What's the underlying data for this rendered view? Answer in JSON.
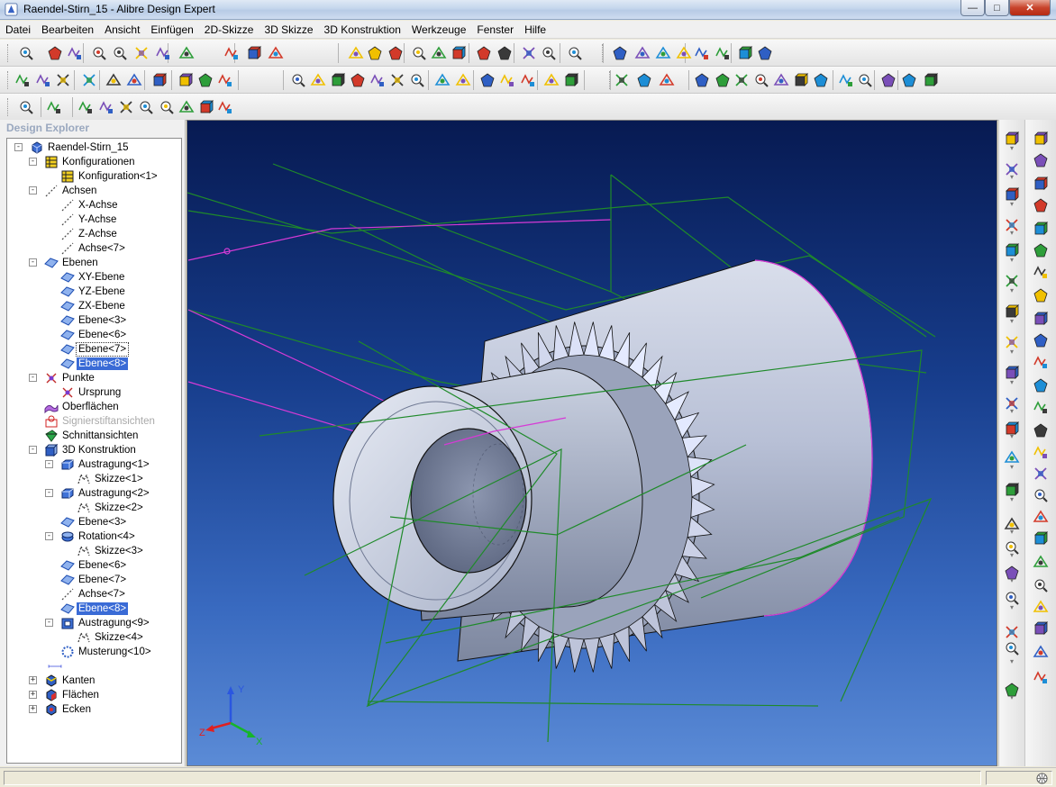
{
  "window": {
    "title": "Raendel-Stirn_15 - Alibre Design Expert"
  },
  "menu": [
    "Datei",
    "Bearbeiten",
    "Ansicht",
    "Einfügen",
    "2D-Skizze",
    "3D Skizze",
    "3D Konstruktion",
    "Werkzeuge",
    "Fenster",
    "Hilfe"
  ],
  "explorer": {
    "title": "Design Explorer",
    "tree": [
      {
        "label": "Raendel-Stirn_15",
        "icon": "part-icon",
        "depth": 0,
        "expander": "-"
      },
      {
        "label": "Konfigurationen",
        "icon": "table-icon",
        "depth": 1,
        "expander": "-"
      },
      {
        "label": "Konfiguration<1>",
        "icon": "table-icon",
        "depth": 2,
        "expander": ""
      },
      {
        "label": "Achsen",
        "icon": "axis-icon",
        "depth": 1,
        "expander": "-"
      },
      {
        "label": "X-Achse",
        "icon": "axis-icon",
        "depth": 2,
        "expander": ""
      },
      {
        "label": "Y-Achse",
        "icon": "axis-icon",
        "depth": 2,
        "expander": ""
      },
      {
        "label": "Z-Achse",
        "icon": "axis-icon",
        "depth": 2,
        "expander": ""
      },
      {
        "label": "Achse<7>",
        "icon": "axis-icon",
        "depth": 2,
        "expander": ""
      },
      {
        "label": "Ebenen",
        "icon": "plane-icon",
        "depth": 1,
        "expander": "-"
      },
      {
        "label": "XY-Ebene",
        "icon": "plane-icon",
        "depth": 2,
        "expander": ""
      },
      {
        "label": "YZ-Ebene",
        "icon": "plane-icon",
        "depth": 2,
        "expander": ""
      },
      {
        "label": "ZX-Ebene",
        "icon": "plane-icon",
        "depth": 2,
        "expander": ""
      },
      {
        "label": "Ebene<3>",
        "icon": "plane-icon",
        "depth": 2,
        "expander": ""
      },
      {
        "label": "Ebene<6>",
        "icon": "plane-icon",
        "depth": 2,
        "expander": ""
      },
      {
        "label": "Ebene<7>",
        "icon": "plane-icon",
        "depth": 2,
        "expander": "",
        "state": "focus"
      },
      {
        "label": "Ebene<8>",
        "icon": "plane-icon",
        "depth": 2,
        "expander": "",
        "state": "selected"
      },
      {
        "label": "Punkte",
        "icon": "point-icon",
        "depth": 1,
        "expander": "-"
      },
      {
        "label": "Ursprung",
        "icon": "point-icon",
        "depth": 2,
        "expander": ""
      },
      {
        "label": "Oberflächen",
        "icon": "surface-icon",
        "depth": 1,
        "expander": ""
      },
      {
        "label": "Signierstiftansichten",
        "icon": "redline-icon",
        "depth": 1,
        "expander": "",
        "state": "dim"
      },
      {
        "label": "Schnittansichten",
        "icon": "section-icon",
        "depth": 1,
        "expander": ""
      },
      {
        "label": "3D Konstruktion",
        "icon": "design-icon",
        "depth": 1,
        "expander": "-"
      },
      {
        "label": "Austragung<1>",
        "icon": "extrude-icon",
        "depth": 2,
        "expander": "-"
      },
      {
        "label": "Skizze<1>",
        "icon": "sketch-icon",
        "depth": 3,
        "expander": ""
      },
      {
        "label": "Austragung<2>",
        "icon": "extrude-icon",
        "depth": 2,
        "expander": "-"
      },
      {
        "label": "Skizze<2>",
        "icon": "sketch-icon",
        "depth": 3,
        "expander": ""
      },
      {
        "label": "Ebene<3>",
        "icon": "plane-icon",
        "depth": 2,
        "expander": ""
      },
      {
        "label": "Rotation<4>",
        "icon": "revolve-icon",
        "depth": 2,
        "expander": "-"
      },
      {
        "label": "Skizze<3>",
        "icon": "sketch-icon",
        "depth": 3,
        "expander": ""
      },
      {
        "label": "Ebene<6>",
        "icon": "plane-icon",
        "depth": 2,
        "expander": ""
      },
      {
        "label": "Ebene<7>",
        "icon": "plane-icon",
        "depth": 2,
        "expander": ""
      },
      {
        "label": "Achse<7>",
        "icon": "axis-icon",
        "depth": 2,
        "expander": ""
      },
      {
        "label": "Ebene<8>",
        "icon": "plane-icon",
        "depth": 2,
        "expander": "",
        "state": "selected"
      },
      {
        "label": "Austragung<9>",
        "icon": "cut-extrude-icon",
        "depth": 2,
        "expander": "-"
      },
      {
        "label": "Skizze<4>",
        "icon": "sketch-icon",
        "depth": 3,
        "expander": ""
      },
      {
        "label": "Musterung<10>",
        "icon": "pattern-icon",
        "depth": 2,
        "expander": ""
      },
      {
        "label": "",
        "icon": "end-of-part-marker",
        "depth": 2,
        "expander": ""
      },
      {
        "label": "Kanten",
        "icon": "edges-icon",
        "depth": 1,
        "expander": "+"
      },
      {
        "label": "Flächen",
        "icon": "faces-icon",
        "depth": 1,
        "expander": "+"
      },
      {
        "label": "Ecken",
        "icon": "vertices-icon",
        "depth": 1,
        "expander": "+"
      }
    ]
  },
  "viewport": {
    "triad": {
      "x_label": "X",
      "y_label": "Y",
      "z_label": "Z"
    },
    "colors": {
      "model_face": "#b4bdd4",
      "plane": "#1f8a2a",
      "sketch": "#d63ad6",
      "background_top": "#071a52",
      "background_bottom": "#5b8bd6"
    }
  },
  "status": {
    "left_text": ""
  }
}
